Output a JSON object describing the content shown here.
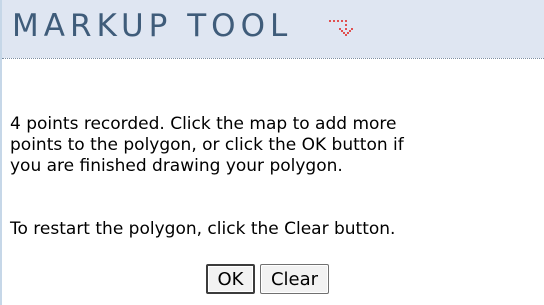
{
  "panel": {
    "title": "MARKUP TOOL",
    "collapse_icon": "down-arrow-icon",
    "accent_color": "#e05050",
    "header_bg": "#dfe6f2",
    "title_color": "#3f5c7a"
  },
  "message": {
    "line1": "4 points recorded. Click the map to add more",
    "line2": "points to the polygon, or click the OK button if",
    "line3": "you are finished drawing your polygon.",
    "restart": "To restart the polygon, click the Clear button."
  },
  "buttons": {
    "ok_label": "OK",
    "clear_label": "Clear"
  }
}
